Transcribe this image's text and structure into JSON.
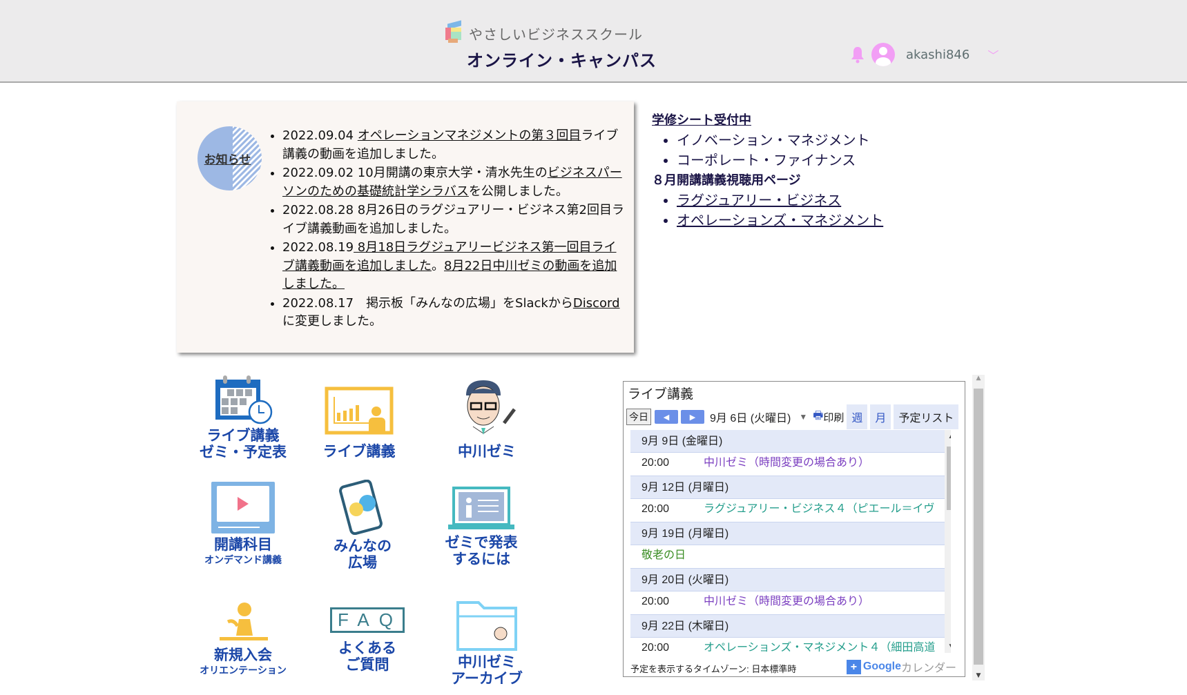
{
  "header": {
    "school_name": "やさしいビジネススクール",
    "campus_title": "オンライン・キャンパス",
    "username": "akashi846",
    "icons": [
      "bell-icon",
      "user-avatar-icon",
      "chevron-down-icon"
    ]
  },
  "notice": {
    "badge": "お知らせ",
    "items": [
      {
        "date": "2022.09.04 ",
        "link": "オペレーションマネジメントの第３回目",
        "text": "ライブ講義の動画を追加しました。"
      },
      {
        "date": "2022.09.02 ",
        "pre": "10月開講の東京大学・清水先生の",
        "link": "ビジネスパーソンのための基礎統計学シラバス",
        "text": "を公開しました。"
      },
      {
        "date": "2022.08.28 ",
        "text": "8月26日のラグジュアリー・ビジネス第2回目ライブ講義動画を追加しました。"
      },
      {
        "date": "2022.08.19",
        "link": " 8月18日ラグジュアリービジネス第一回目ライブ講義動画を追加しました",
        "mid": "。",
        "link2": "8月22日中川ゼミの動画を追加しました。"
      },
      {
        "date": "2022.08.17　",
        "text": "掲示板「みんなの広場」をSlackから",
        "link": "Discord",
        "text2": "に変更しました。"
      }
    ]
  },
  "side": {
    "heading1": "学修シート受付中",
    "list1": [
      "イノベーション・マネジメント",
      "コーポレート・ファイナンス"
    ],
    "heading2": "８月開講講義視聴用ページ",
    "list2": [
      "ラグジュアリー・ビジネス",
      "オペレーションズ・マネジメント"
    ]
  },
  "tiles": [
    {
      "label": "ライブ講義",
      "label2": "ゼミ・予定表"
    },
    {
      "label": "ライブ講義"
    },
    {
      "label": "中川ゼミ"
    },
    {
      "label": "開講科目",
      "sub": "オンデマンド講義"
    },
    {
      "label": "みんなの",
      "label2": "広場"
    },
    {
      "label": "ゼミで発表",
      "label2": "するには"
    },
    {
      "label": "新規入会",
      "sub": "オリエンテーション"
    },
    {
      "label": "よくある",
      "label2": "ご質問",
      "faq": "FAQ"
    },
    {
      "label": "中川ゼミ",
      "label2": "アーカイブ"
    }
  ],
  "calendar": {
    "title": "ライブ講義",
    "today": "今日",
    "date": "9月 6日 (火曜日)",
    "print": "印刷",
    "tabs": [
      "週",
      "月",
      "予定リスト"
    ],
    "days": [
      {
        "date": "9月 9日 (金曜日)",
        "events": [
          {
            "time": "20:00",
            "title": "中川ゼミ（時間変更の場合あり）",
            "color": "purple"
          }
        ]
      },
      {
        "date": "9月 12日 (月曜日)",
        "events": [
          {
            "time": "20:00",
            "title": "ラグジュアリー・ビジネス４（ピエール＝イヴ",
            "color": "teal"
          }
        ]
      },
      {
        "date": "9月 19日 (月曜日)",
        "events": [
          {
            "time": "",
            "title": "敬老の日",
            "color": "green"
          }
        ]
      },
      {
        "date": "9月 20日 (火曜日)",
        "events": [
          {
            "time": "20:00",
            "title": "中川ゼミ（時間変更の場合あり）",
            "color": "purple"
          }
        ]
      },
      {
        "date": "9月 22日 (木曜日)",
        "events": [
          {
            "time": "20:00",
            "title": "オペレーションズ・マネジメント４（細田高道",
            "color": "teal"
          }
        ]
      }
    ],
    "timezone": "予定を表示するタイムゾーン: 日本標準時",
    "google": "Google",
    "google_cal": "カレンダー"
  }
}
